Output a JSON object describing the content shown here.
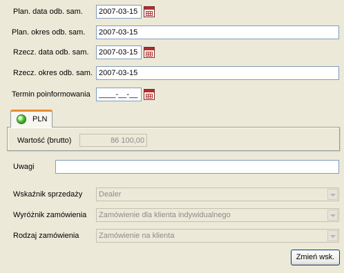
{
  "rows": {
    "plan_data": {
      "label": "Plan. data odb. sam.",
      "value": "2007-03-15"
    },
    "plan_okres": {
      "label": "Plan. okres odb. sam.",
      "value": "2007-03-15"
    },
    "rzecz_data": {
      "label": "Rzecz. data odb. sam.",
      "value": "2007-03-15"
    },
    "rzecz_okres": {
      "label": "Rzecz. okres odb. sam.",
      "value": "2007-03-15"
    },
    "termin": {
      "label": "Termin poinformowania",
      "value": "____-__-__"
    }
  },
  "tab": {
    "label": "PLN",
    "status_color": "#4cc42a"
  },
  "wartosc": {
    "label": "Wartość (brutto)",
    "value": "86 100,00"
  },
  "uwagi": {
    "label": "Uwagi",
    "value": ""
  },
  "wskaznik": {
    "label": "Wskaźnik sprzedaży",
    "value": "Dealer"
  },
  "wyroznik": {
    "label": "Wyróżnik zamówienia",
    "value": "Zamówienie dla klienta indywidualnego"
  },
  "rodzaj": {
    "label": "Rodzaj zamówienia",
    "value": "Zamówienie na klienta"
  },
  "button": {
    "label": "Zmień wsk."
  }
}
